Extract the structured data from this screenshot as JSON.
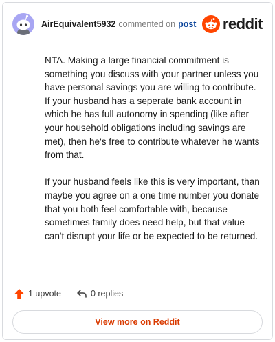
{
  "header": {
    "username": "AirEquivalent5932",
    "commented_text": "commented on",
    "post_link": "post",
    "brand_name": "reddit"
  },
  "comment": {
    "paragraphs": [
      "NTA. Making a large financial commitment is something you discuss with your partner unless you have personal savings you are willing to contribute. If your husband has a seperate bank account in which he has full autonomy in spending (like after your household obligations including savings are met), then he's free to contribute whatever he wants from that.",
      "If your husband feels like this is very important, than maybe you agree on a one time number you donate that you both feel comfortable with, because sometimes family does need help, but that value can't disrupt your life or be expected to be returned."
    ]
  },
  "actions": {
    "upvote_label": "1 upvote",
    "replies_label": "0 replies"
  },
  "footer": {
    "view_more_label": "View more on Reddit"
  },
  "icons": {
    "avatar": "snoo-avatar-icon",
    "brand": "reddit-logo-icon",
    "upvote": "upvote-arrow-icon",
    "reply": "reply-arrow-icon"
  },
  "colors": {
    "accent": "#d93a00",
    "upvote": "#ff4500",
    "post_link": "#0a449b",
    "avatar_bg": "#a8a6f3"
  }
}
